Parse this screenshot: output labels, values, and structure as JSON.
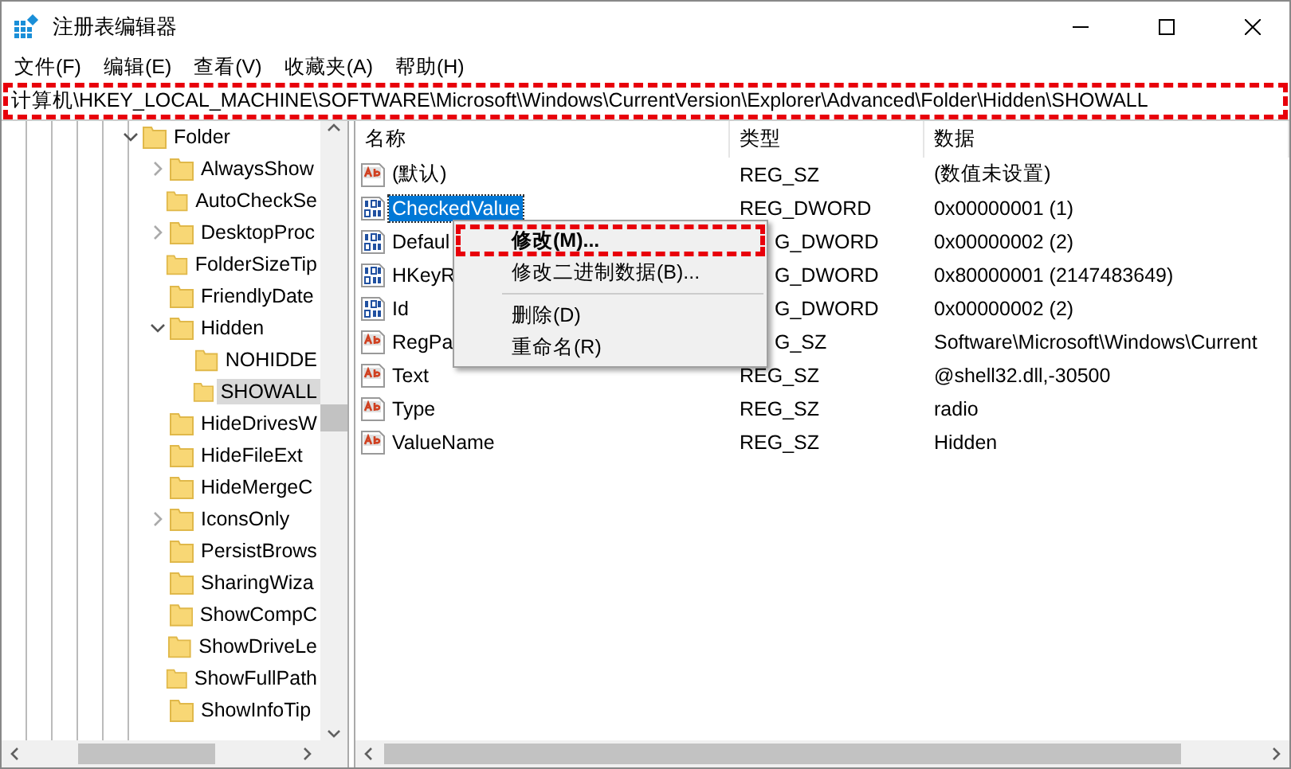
{
  "window": {
    "title": "注册表编辑器"
  },
  "menu": [
    "文件(F)",
    "编辑(E)",
    "查看(V)",
    "收藏夹(A)",
    "帮助(H)"
  ],
  "address": {
    "value": "计算机\\HKEY_LOCAL_MACHINE\\SOFTWARE\\Microsoft\\Windows\\CurrentVersion\\Explorer\\Advanced\\Folder\\Hidden\\SHOWALL",
    "highlighted": true
  },
  "tree": [
    {
      "label": "Folder",
      "expanded": true,
      "selected": false,
      "children": [
        {
          "label": "AlwaysShow",
          "expanded": false,
          "selected": false
        },
        {
          "label": "AutoCheckSe",
          "selected": false
        },
        {
          "label": "DesktopProc",
          "expanded": false,
          "selected": false
        },
        {
          "label": "FolderSizeTip",
          "selected": false
        },
        {
          "label": "FriendlyDate",
          "selected": false
        },
        {
          "label": "Hidden",
          "expanded": true,
          "selected": false,
          "children": [
            {
              "label": "NOHIDDE",
              "selected": false
            },
            {
              "label": "SHOWALL",
              "selected": true
            }
          ]
        },
        {
          "label": "HideDrivesW",
          "selected": false
        },
        {
          "label": "HideFileExt",
          "selected": false
        },
        {
          "label": "HideMergeC",
          "selected": false
        },
        {
          "label": "IconsOnly",
          "expanded": false,
          "selected": false
        },
        {
          "label": "PersistBrows",
          "selected": false
        },
        {
          "label": "SharingWiza",
          "selected": false
        },
        {
          "label": "ShowCompC",
          "selected": false
        },
        {
          "label": "ShowDriveLe",
          "selected": false
        },
        {
          "label": "ShowFullPath",
          "selected": false
        },
        {
          "label": "ShowInfoTip",
          "selected": false
        }
      ]
    }
  ],
  "table": {
    "columns": [
      "名称",
      "类型",
      "数据"
    ],
    "rows": [
      {
        "kind": "string",
        "name": "(默认)",
        "type": "REG_SZ",
        "type_partly_hidden": false,
        "data": "(数值未设置)",
        "selected": false
      },
      {
        "kind": "dword",
        "name": "CheckedValue",
        "type": "REG_DWORD",
        "type_partly_hidden": false,
        "data": "0x00000001 (1)",
        "selected": true
      },
      {
        "kind": "dword",
        "name": "Defaul",
        "type": "G_DWORD",
        "type_partly_hidden": true,
        "data": "0x00000002 (2)",
        "selected": false
      },
      {
        "kind": "dword",
        "name": "HKeyR",
        "type": "G_DWORD",
        "type_partly_hidden": true,
        "data": "0x80000001 (2147483649)",
        "selected": false
      },
      {
        "kind": "dword",
        "name": "Id",
        "type": "G_DWORD",
        "type_partly_hidden": true,
        "data": "0x00000002 (2)",
        "selected": false
      },
      {
        "kind": "string",
        "name": "RegPa",
        "type": "G_SZ",
        "type_partly_hidden": true,
        "data": "Software\\Microsoft\\Windows\\Current",
        "selected": false
      },
      {
        "kind": "string",
        "name": "Text",
        "type": "REG_SZ",
        "type_partly_hidden": false,
        "data": "@shell32.dll,-30500",
        "selected": false
      },
      {
        "kind": "string",
        "name": "Type",
        "type": "REG_SZ",
        "type_partly_hidden": false,
        "data": "radio",
        "selected": false
      },
      {
        "kind": "string",
        "name": "ValueName",
        "type": "REG_SZ",
        "type_partly_hidden": false,
        "data": "Hidden",
        "selected": false
      }
    ]
  },
  "context_menu": [
    {
      "kind": "item",
      "label": "修改(M)...",
      "bold": true,
      "highlighted": true
    },
    {
      "kind": "item",
      "label": "修改二进制数据(B)...",
      "bold": false,
      "highlighted": false
    },
    {
      "kind": "separator"
    },
    {
      "kind": "item",
      "label": "删除(D)",
      "bold": false,
      "highlighted": false
    },
    {
      "kind": "item",
      "label": "重命名(R)",
      "bold": false,
      "highlighted": false
    }
  ]
}
